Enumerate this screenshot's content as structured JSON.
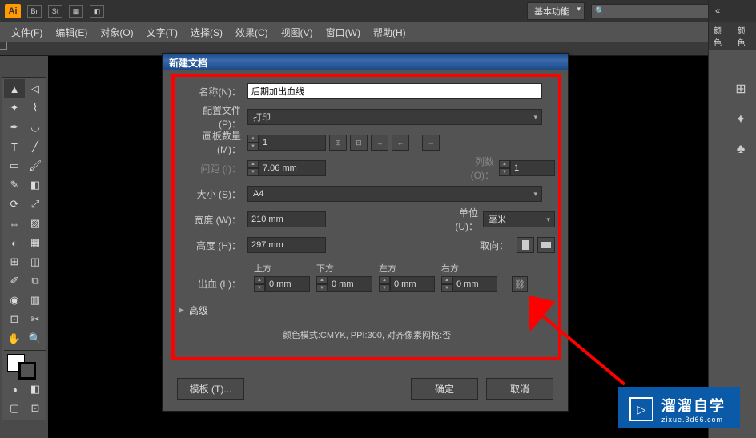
{
  "app": {
    "logo": "Ai",
    "workspace": "基本功能"
  },
  "menu": {
    "file": "文件(F)",
    "edit": "编辑(E)",
    "object": "对象(O)",
    "type": "文字(T)",
    "select": "选择(S)",
    "effect": "效果(C)",
    "view": "视图(V)",
    "window": "窗口(W)",
    "help": "帮助(H)"
  },
  "right_panel": {
    "tab1": "颜色",
    "tab2": "颜色"
  },
  "dialog": {
    "title": "新建文档",
    "labels": {
      "name": "名称(N)：",
      "profile": "配置文件 (P)：",
      "artboards": "画板数量 (M)：",
      "spacing": "间距 (I)：",
      "columns": "列数 (O)：",
      "size": "大小 (S)：",
      "width": "宽度 (W)：",
      "height": "高度 (H)：",
      "units": "单位 (U)：",
      "orientation": "取向：",
      "bleed": "出血 (L)：",
      "advanced": "高级",
      "top": "上方",
      "bottom": "下方",
      "left": "左方",
      "right": "右方"
    },
    "values": {
      "name": "后期加出血线",
      "profile": "打印",
      "artboards": "1",
      "spacing": "7.06 mm",
      "columns": "1",
      "size": "A4",
      "width": "210 mm",
      "height": "297 mm",
      "units": "毫米",
      "bleed_top": "0 mm",
      "bleed_bottom": "0 mm",
      "bleed_left": "0 mm",
      "bleed_right": "0 mm"
    },
    "color_mode": "颜色模式:CMYK, PPI:300, 对齐像素网格:否",
    "buttons": {
      "template": "模板 (T)...",
      "ok": "确定",
      "cancel": "取消"
    }
  },
  "badge": {
    "title": "溜溜自学",
    "sub": "zixue.3d66.com"
  }
}
